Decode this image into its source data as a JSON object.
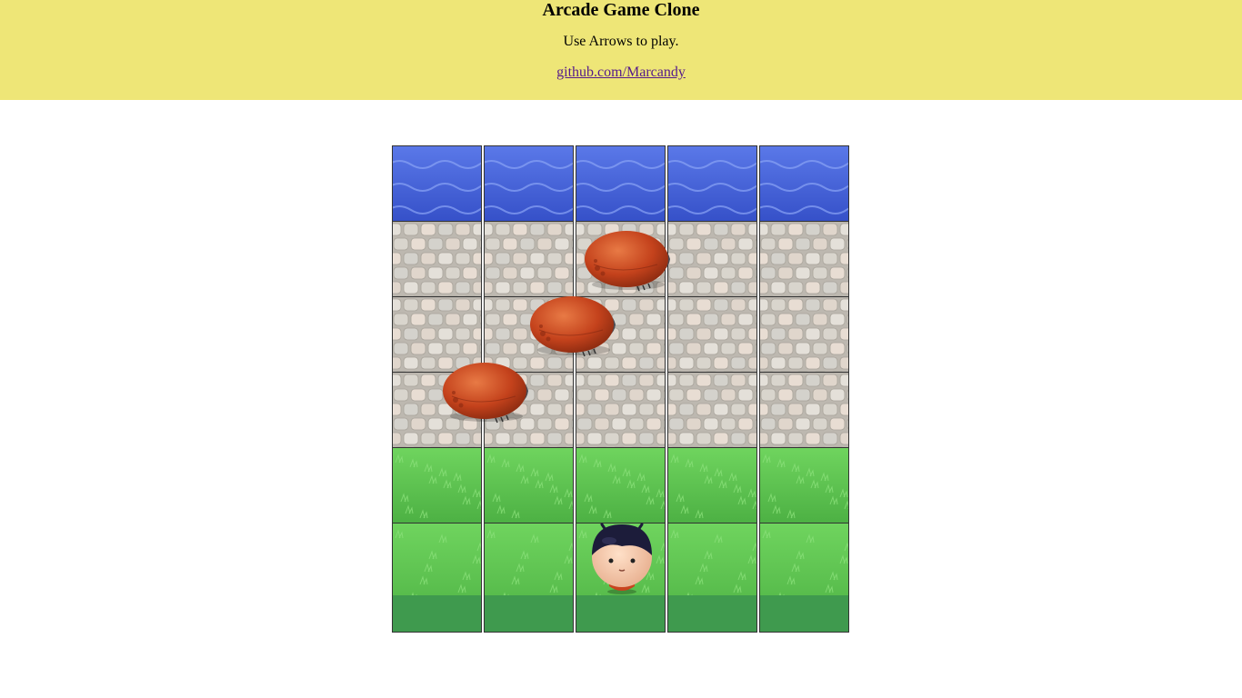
{
  "header": {
    "title": "Arcade Game Clone",
    "instructions": "Use Arrows to play.",
    "link_text": "github.com/Marcandy"
  },
  "game": {
    "columns": 5,
    "rows": [
      "water",
      "stone",
      "stone",
      "stone",
      "grass",
      "grass"
    ],
    "enemies": [
      {
        "name": "enemy-bug",
        "row": 1,
        "col": 2.1
      },
      {
        "name": "enemy-bug",
        "row": 2,
        "col": 1.5
      },
      {
        "name": "enemy-bug",
        "row": 3,
        "col": 0.55
      }
    ],
    "player": {
      "name": "player-boy",
      "row": 5,
      "col": 2
    },
    "colors": {
      "water": "#3d5bd6",
      "stone": "#d7d3cc",
      "grass": "#5bc44f",
      "grass_dark": "#3f9a4e",
      "bug": "#c8441f"
    }
  }
}
